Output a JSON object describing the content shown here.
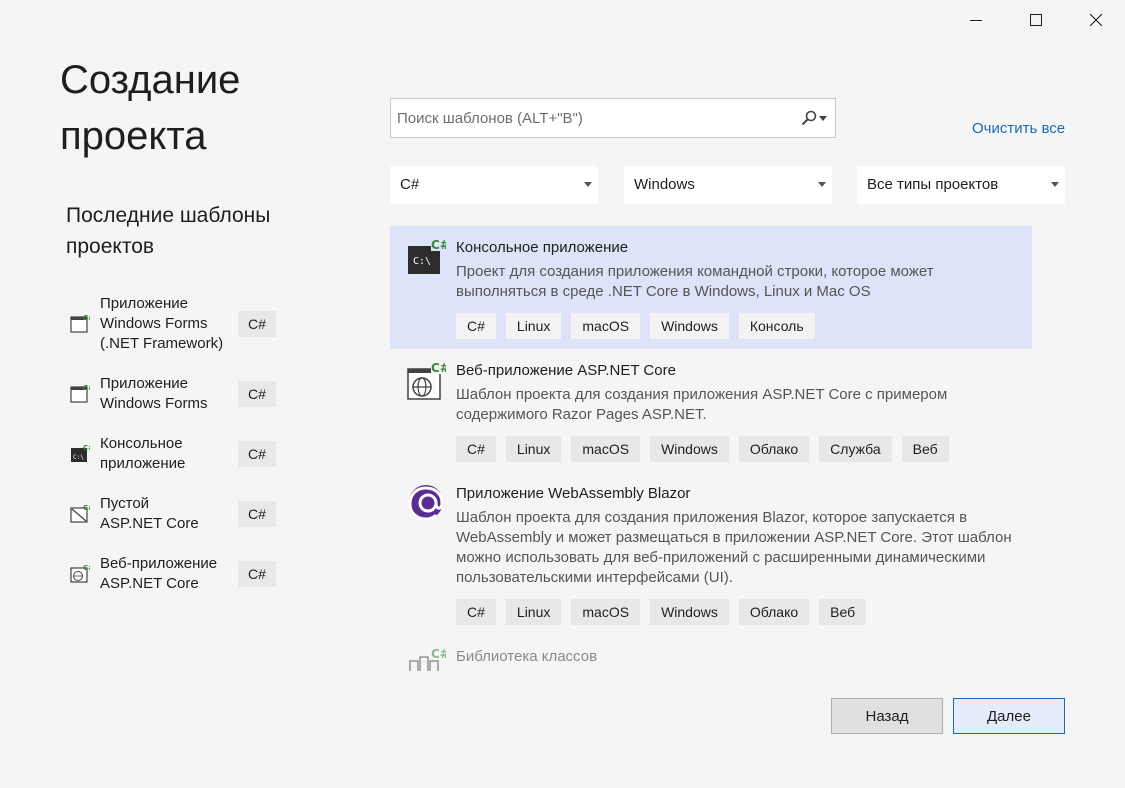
{
  "window": {
    "title_line1": "Создание",
    "title_line2": "проекта"
  },
  "recent": {
    "heading_line1": "Последние шаблоны",
    "heading_line2": "проектов",
    "items": [
      {
        "line1": "Приложение",
        "line2": "Windows Forms",
        "line3": "(.NET Framework)",
        "lang": "C#",
        "icon": "windows-forms-icon"
      },
      {
        "line1": "Приложение",
        "line2": "Windows Forms",
        "line3": "",
        "lang": "C#",
        "icon": "windows-forms-icon"
      },
      {
        "line1": "Консольное",
        "line2": "приложение",
        "line3": "",
        "lang": "C#",
        "icon": "console-app-icon"
      },
      {
        "line1": "Пустой",
        "line2": "ASP.NET Core",
        "line3": "",
        "lang": "C#",
        "icon": "empty-aspnet-icon"
      },
      {
        "line1": "Веб-приложение",
        "line2": "ASP.NET Core",
        "line3": "",
        "lang": "C#",
        "icon": "web-app-icon"
      }
    ]
  },
  "search": {
    "placeholder": "Поиск шаблонов (ALT+\"В\")",
    "value": ""
  },
  "clear_all": "Очистить все",
  "filters": {
    "language": "C#",
    "platform": "Windows",
    "project_type": "Все типы проектов"
  },
  "templates": [
    {
      "title": "Консольное приложение",
      "desc_line1": "Проект для создания приложения командной строки, которое может",
      "desc_line2": "выполняться в среде .NET Core в Windows, Linux и Mac OS",
      "desc_line3": "",
      "desc_line4": "",
      "tags": [
        "C#",
        "Linux",
        "macOS",
        "Windows",
        "Консоль"
      ],
      "icon": "console-app-icon",
      "selected": true
    },
    {
      "title": "Веб-приложение ASP.NET Core",
      "desc_line1": "Шаблон проекта для создания приложения ASP.NET Core с примером",
      "desc_line2": "содержимого Razor Pages ASP.NET.",
      "desc_line3": "",
      "desc_line4": "",
      "tags": [
        "C#",
        "Linux",
        "macOS",
        "Windows",
        "Облако",
        "Служба",
        "Веб"
      ],
      "icon": "web-app-icon",
      "selected": false
    },
    {
      "title": "Приложение WebAssembly Blazor",
      "desc_line1": "Шаблон проекта для создания приложения Blazor, которое запускается в",
      "desc_line2": "WebAssembly и может размещаться в приложении ASP.NET Core. Этот шаблон",
      "desc_line3": "можно использовать для веб-приложений с расширенными динамическими",
      "desc_line4": "пользовательскими интерфейсами (UI).",
      "tags": [
        "C#",
        "Linux",
        "macOS",
        "Windows",
        "Облако",
        "Веб"
      ],
      "icon": "blazor-icon",
      "selected": false
    },
    {
      "title": "Библиотека классов",
      "icon": "class-library-icon",
      "selected": false
    }
  ],
  "buttons": {
    "back": "Назад",
    "next": "Далее"
  },
  "colors": {
    "accent": "#1a6bb8",
    "selected_bg": "#dde3f8",
    "tag_bg": "#e8e8e8",
    "csharp_green": "#388a34",
    "blazor_purple": "#5c2d91"
  }
}
